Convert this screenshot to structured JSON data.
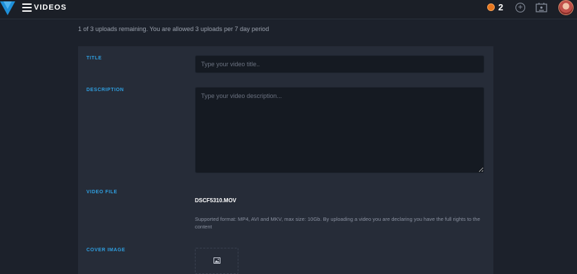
{
  "header": {
    "title": "VIDEOS",
    "coins": "2",
    "icons": {
      "logo": "vertical-logo-icon",
      "menu": "hamburger-menu-icon",
      "coin": "coin-icon",
      "add": "plus-circle-icon",
      "studio": "studio-icon",
      "avatar": "user-avatar"
    }
  },
  "upload_limit": "1 of 3 uploads remaining. You are allowed 3 uploads per 7 day period",
  "form": {
    "title": {
      "label": "TITLE",
      "value": "",
      "placeholder": "Type your video title.."
    },
    "description": {
      "label": "DESCRIPTION",
      "value": "",
      "placeholder": "Type your video description..."
    },
    "video_file": {
      "label": "VIDEO FILE",
      "filename": "DSCF5310.MOV",
      "help": "Supported format: MP4, AVI and MKV, max size: 10Gb. By uploading a video you are declaring you have the full rights to the content"
    },
    "cover_image": {
      "label": "COVER IMAGE",
      "icon": "image-icon"
    }
  },
  "colors": {
    "background": "#1c212b",
    "topbar": "#1b1f27",
    "card": "#262c38",
    "input": "#151a22",
    "accent_label": "#2f9fe0",
    "coin": "#e9771f",
    "logo": "#1e8fd8"
  }
}
